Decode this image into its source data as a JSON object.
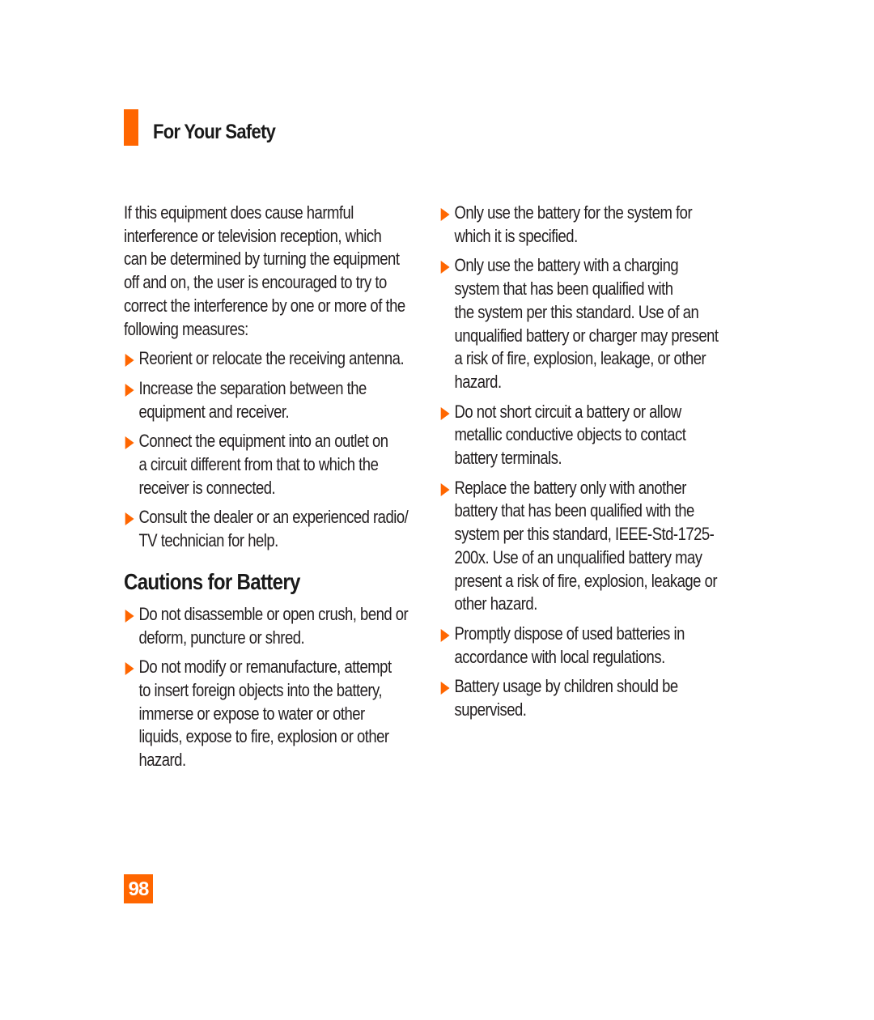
{
  "header": {
    "title": "For Your Safety",
    "accent_color": "#ff6600"
  },
  "left_column": {
    "intro_lines": [
      "If this equipment does cause harmful",
      "interference or television reception, which",
      "can be determined by turning the equipment",
      "off and on, the user is encouraged to try to",
      "correct the interference by one or more of the",
      "following measures:"
    ],
    "measures": [
      {
        "lines": [
          "Reorient or relocate the receiving antenna."
        ]
      },
      {
        "lines": [
          "Increase the separation between the",
          "equipment and receiver."
        ]
      },
      {
        "lines": [
          "Connect the equipment into an outlet on",
          "a circuit different from that to which the",
          "receiver is connected."
        ]
      },
      {
        "lines": [
          "Consult the dealer or an experienced radio/",
          "TV technician for help."
        ]
      }
    ],
    "section_title": "Cautions for Battery",
    "cautions": [
      {
        "lines": [
          "Do not disassemble or open crush, bend or",
          "deform, puncture or shred."
        ]
      },
      {
        "lines": [
          "Do not modify or remanufacture, attempt",
          "to insert foreign objects into the battery,",
          "immerse or expose to water or other",
          "liquids, expose to fire, explosion or other",
          "hazard."
        ]
      }
    ]
  },
  "right_column": {
    "cautions": [
      {
        "lines": [
          "Only use the battery for the system for",
          "which it is specified."
        ]
      },
      {
        "lines": [
          "Only use the battery with a charging",
          "system that has been qualified with",
          "the system per this standard. Use of an",
          "unqualified battery or charger may present",
          "a risk of fire, explosion, leakage, or other",
          "hazard."
        ]
      },
      {
        "lines": [
          "Do not short circuit a battery or allow",
          "metallic conductive objects to contact",
          "battery terminals."
        ]
      },
      {
        "lines": [
          "Replace the battery only with another",
          "battery that has been qualified with the",
          "system per this standard, IEEE-Std-1725-",
          "200x. Use of an unqualified battery may",
          "present a risk of fire, explosion, leakage or",
          "other hazard."
        ]
      },
      {
        "lines": [
          "Promptly dispose of used batteries in",
          "accordance with local regulations."
        ]
      },
      {
        "lines": [
          "Battery usage by children should be",
          "supervised."
        ]
      }
    ]
  },
  "footer": {
    "page_number": "98"
  },
  "icons": {
    "bullet": "orange-triangle-arrow-icon"
  }
}
